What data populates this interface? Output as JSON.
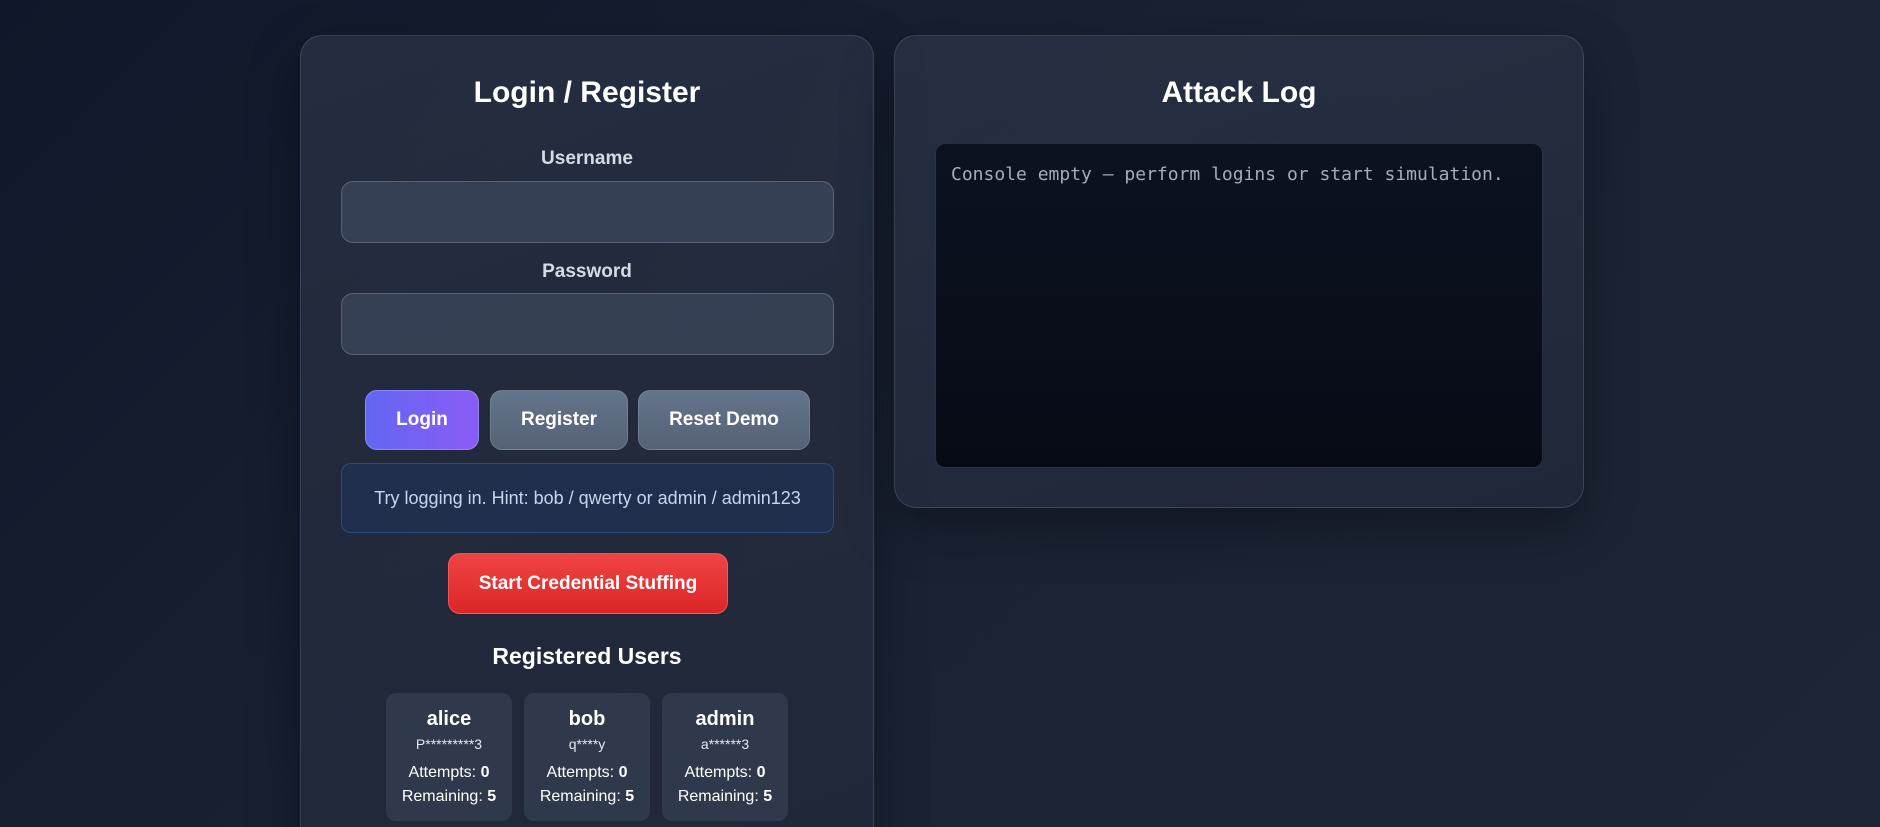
{
  "login_panel": {
    "title": "Login / Register",
    "username_label": "Username",
    "username_value": "",
    "password_label": "Password",
    "password_value": "",
    "buttons": {
      "login": "Login",
      "register": "Register",
      "reset": "Reset Demo"
    },
    "hint": "Try logging in. Hint: bob / qwerty or admin / admin123",
    "stuffing_button": "Start Credential Stuffing",
    "users_title": "Registered Users",
    "attempts_label": "Attempts:",
    "remaining_label": "Remaining:",
    "users": [
      {
        "name": "alice",
        "masked_password": "P*********3",
        "attempts": "0",
        "remaining": "5"
      },
      {
        "name": "bob",
        "masked_password": "q****y",
        "attempts": "0",
        "remaining": "5"
      },
      {
        "name": "admin",
        "masked_password": "a******3",
        "attempts": "0",
        "remaining": "5"
      }
    ]
  },
  "log_panel": {
    "title": "Attack Log",
    "console_text": "Console empty — perform logins or start simulation."
  },
  "colors": {
    "primary": "#6366f1",
    "primary_end": "#8b5cf6",
    "danger": "#ef4444",
    "secondary": "#64748b",
    "background": "#0f172a"
  }
}
